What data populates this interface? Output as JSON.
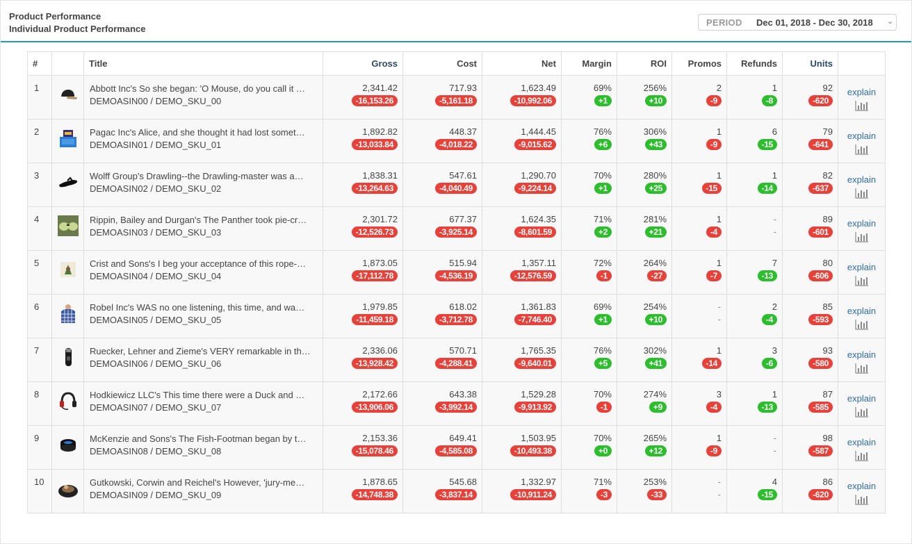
{
  "header": {
    "title": "Product Performance",
    "subtitle": "Individual Product Performance",
    "period_label": "PERIOD",
    "period_value": "Dec 01, 2018 - Dec 30, 2018"
  },
  "columns": [
    "#",
    "",
    "Title",
    "Gross",
    "Cost",
    "Net",
    "Margin",
    "ROI",
    "Promos",
    "Refunds",
    "Units",
    ""
  ],
  "explain_label": "explain",
  "rows": [
    {
      "idx": "1",
      "icon": "cap-icon",
      "title": "Abbott Inc's So she began: 'O Mouse, do you call it …",
      "sku": "DEMOASIN00 / DEMO_SKU_00",
      "gross": "2,341.42",
      "gross_d": "-16,153.26",
      "cost": "717.93",
      "cost_d": "-5,161.18",
      "net": "1,623.49",
      "net_d": "-10,992.06",
      "margin": "69%",
      "margin_d": "+1",
      "margin_c": "green",
      "roi": "256%",
      "roi_d": "+10",
      "roi_c": "green",
      "promos": "2",
      "promos_d": "-9",
      "promos_c": "red",
      "refunds": "1",
      "refunds_d": "-8",
      "refunds_c": "green",
      "units": "92",
      "units_d": "-620"
    },
    {
      "idx": "2",
      "icon": "box-icon",
      "title": "Pagac Inc's Alice, and she thought it had lost somet…",
      "sku": "DEMOASIN01 / DEMO_SKU_01",
      "gross": "1,892.82",
      "gross_d": "-13,033.84",
      "cost": "448.37",
      "cost_d": "-4,018.22",
      "net": "1,444.45",
      "net_d": "-9,015.62",
      "margin": "76%",
      "margin_d": "+6",
      "margin_c": "green",
      "roi": "306%",
      "roi_d": "+43",
      "roi_c": "green",
      "promos": "1",
      "promos_d": "-9",
      "promos_c": "red",
      "refunds": "6",
      "refunds_d": "-15",
      "refunds_c": "green",
      "units": "79",
      "units_d": "-641"
    },
    {
      "idx": "3",
      "icon": "sandal-icon",
      "title": "Wolff Group's Drawling--the Drawling-master was a…",
      "sku": "DEMOASIN02 / DEMO_SKU_02",
      "gross": "1,838.31",
      "gross_d": "-13,264.63",
      "cost": "547.61",
      "cost_d": "-4,040.49",
      "net": "1,290.70",
      "net_d": "-9,224.14",
      "margin": "70%",
      "margin_d": "+1",
      "margin_c": "green",
      "roi": "280%",
      "roi_d": "+25",
      "roi_c": "green",
      "promos": "1",
      "promos_d": "-15",
      "promos_c": "red",
      "refunds": "1",
      "refunds_d": "-14",
      "refunds_c": "green",
      "units": "82",
      "units_d": "-637"
    },
    {
      "idx": "4",
      "icon": "sunglasses-icon",
      "title": "Rippin, Bailey and Durgan's The Panther took pie-cr…",
      "sku": "DEMOASIN03 / DEMO_SKU_03",
      "gross": "2,301.72",
      "gross_d": "-12,526.73",
      "cost": "677.37",
      "cost_d": "-3,925.14",
      "net": "1,624.35",
      "net_d": "-8,601.59",
      "margin": "71%",
      "margin_d": "+2",
      "margin_c": "green",
      "roi": "281%",
      "roi_d": "+21",
      "roi_c": "green",
      "promos": "1",
      "promos_d": "-4",
      "promos_c": "red",
      "refunds": "-",
      "refunds_d": "-",
      "refunds_c": "none",
      "units": "89",
      "units_d": "-601"
    },
    {
      "idx": "5",
      "icon": "pillow-icon",
      "title": "Crist and Sons's I beg your acceptance of this rope-…",
      "sku": "DEMOASIN04 / DEMO_SKU_04",
      "gross": "1,873.05",
      "gross_d": "-17,112.78",
      "cost": "515.94",
      "cost_d": "-4,536.19",
      "net": "1,357.11",
      "net_d": "-12,576.59",
      "margin": "72%",
      "margin_d": "-1",
      "margin_c": "red",
      "roi": "264%",
      "roi_d": "-27",
      "roi_c": "red",
      "promos": "1",
      "promos_d": "-7",
      "promos_c": "red",
      "refunds": "7",
      "refunds_d": "-13",
      "refunds_c": "green",
      "units": "80",
      "units_d": "-606"
    },
    {
      "idx": "6",
      "icon": "shirt-icon",
      "title": "Robel Inc's WAS no one listening, this time, and wa…",
      "sku": "DEMOASIN05 / DEMO_SKU_05",
      "gross": "1,979.85",
      "gross_d": "-11,459.18",
      "cost": "618.02",
      "cost_d": "-3,712.78",
      "net": "1,361.83",
      "net_d": "-7,746.40",
      "margin": "69%",
      "margin_d": "+1",
      "margin_c": "green",
      "roi": "254%",
      "roi_d": "+10",
      "roi_c": "green",
      "promos": "-",
      "promos_d": "-",
      "promos_c": "none",
      "refunds": "2",
      "refunds_d": "-4",
      "refunds_c": "green",
      "units": "85",
      "units_d": "-593"
    },
    {
      "idx": "7",
      "icon": "shaver-icon",
      "title": "Ruecker, Lehner and Zieme's VERY remarkable in th…",
      "sku": "DEMOASIN06 / DEMO_SKU_06",
      "gross": "2,336.06",
      "gross_d": "-13,928.42",
      "cost": "570.71",
      "cost_d": "-4,288.41",
      "net": "1,765.35",
      "net_d": "-9,640.01",
      "margin": "76%",
      "margin_d": "+5",
      "margin_c": "green",
      "roi": "302%",
      "roi_d": "+41",
      "roi_c": "green",
      "promos": "1",
      "promos_d": "-14",
      "promos_c": "red",
      "refunds": "3",
      "refunds_d": "-6",
      "refunds_c": "green",
      "units": "93",
      "units_d": "-580"
    },
    {
      "idx": "8",
      "icon": "headset-icon",
      "title": "Hodkiewicz LLC's This time there were a Duck and …",
      "sku": "DEMOASIN07 / DEMO_SKU_07",
      "gross": "2,172.66",
      "gross_d": "-13,906.06",
      "cost": "643.38",
      "cost_d": "-3,992.14",
      "net": "1,529.28",
      "net_d": "-9,913.92",
      "margin": "70%",
      "margin_d": "-1",
      "margin_c": "red",
      "roi": "274%",
      "roi_d": "+9",
      "roi_c": "green",
      "promos": "3",
      "promos_d": "-4",
      "promos_c": "red",
      "refunds": "1",
      "refunds_d": "-13",
      "refunds_c": "green",
      "units": "87",
      "units_d": "-585"
    },
    {
      "idx": "9",
      "icon": "speaker-icon",
      "title": "McKenzie and Sons's The Fish-Footman began by t…",
      "sku": "DEMOASIN08 / DEMO_SKU_08",
      "gross": "2,153.36",
      "gross_d": "-15,078.46",
      "cost": "649.41",
      "cost_d": "-4,585.08",
      "net": "1,503.95",
      "net_d": "-10,493.38",
      "margin": "70%",
      "margin_d": "+0",
      "margin_c": "green",
      "roi": "265%",
      "roi_d": "+12",
      "roi_c": "green",
      "promos": "1",
      "promos_d": "-9",
      "promos_c": "red",
      "refunds": "-",
      "refunds_d": "-",
      "refunds_c": "none",
      "units": "98",
      "units_d": "-587"
    },
    {
      "idx": "10",
      "icon": "pet-bed-icon",
      "title": "Gutkowski, Corwin and Reichel's However, 'jury-me…",
      "sku": "DEMOASIN09 / DEMO_SKU_09",
      "gross": "1,878.65",
      "gross_d": "-14,748.38",
      "cost": "545.68",
      "cost_d": "-3,837.14",
      "net": "1,332.97",
      "net_d": "-10,911.24",
      "margin": "71%",
      "margin_d": "-3",
      "margin_c": "red",
      "roi": "253%",
      "roi_d": "-33",
      "roi_c": "red",
      "promos": "-",
      "promos_d": "-",
      "promos_c": "none",
      "refunds": "4",
      "refunds_d": "-15",
      "refunds_c": "green",
      "units": "86",
      "units_d": "-620"
    }
  ]
}
